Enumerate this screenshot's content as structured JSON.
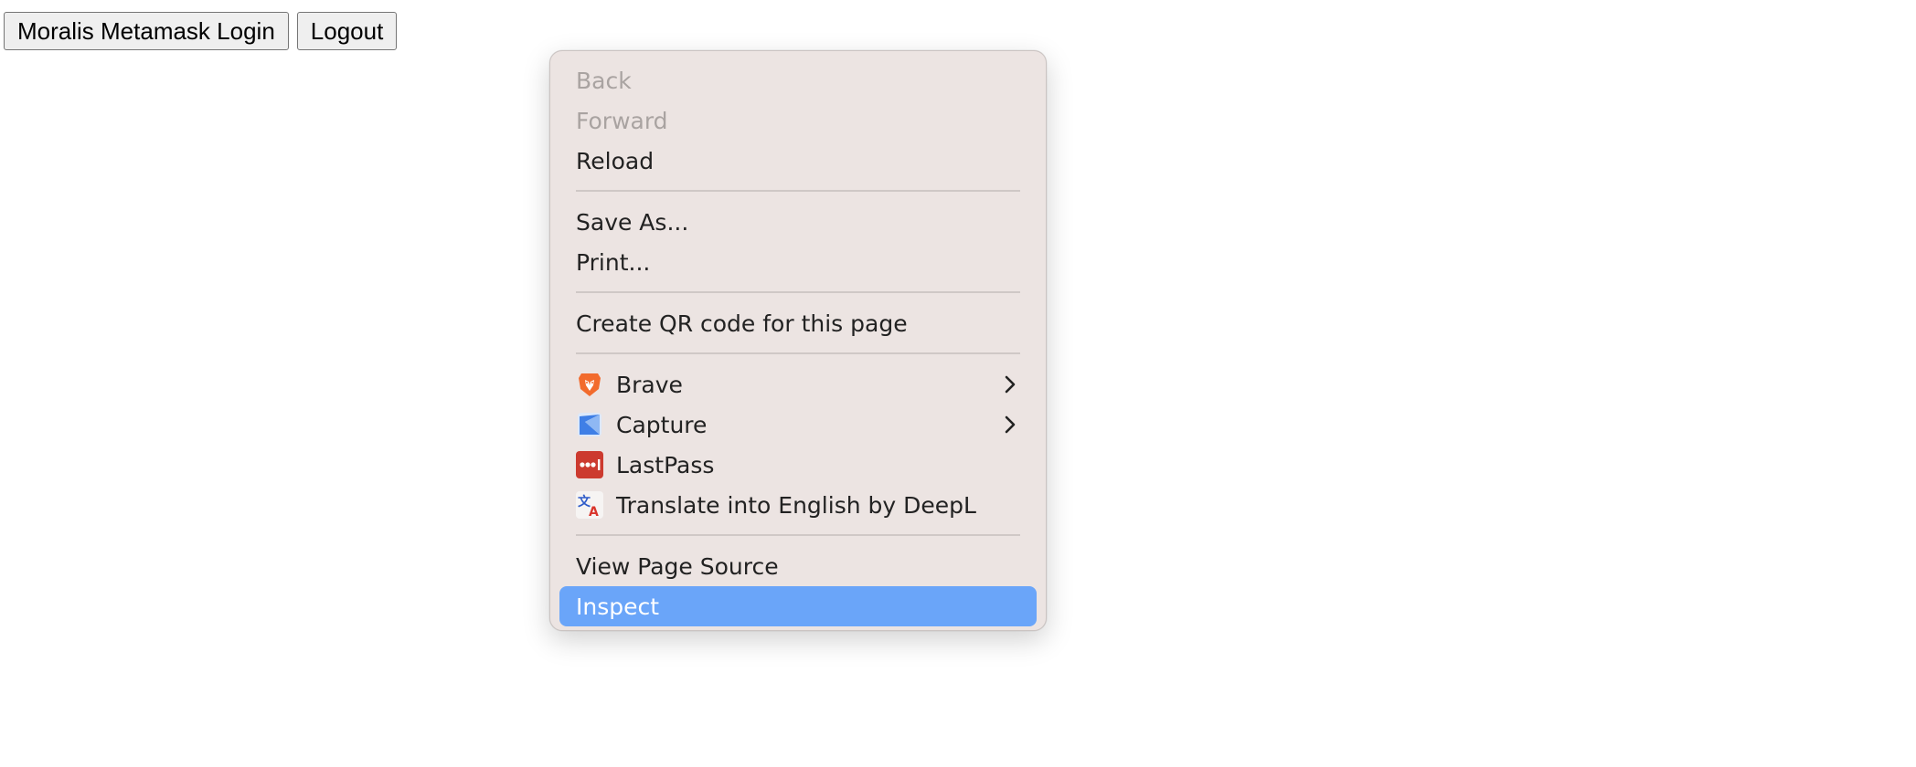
{
  "page": {
    "buttons": {
      "login_label": "Moralis Metamask Login",
      "logout_label": "Logout"
    }
  },
  "context_menu": {
    "back": "Back",
    "forward": "Forward",
    "reload": "Reload",
    "save_as": "Save As...",
    "print": "Print...",
    "create_qr": "Create QR code for this page",
    "extensions": {
      "brave": {
        "label": "Brave",
        "icon": "brave-lion-icon",
        "color": "#f26b2d"
      },
      "capture": {
        "label": "Capture",
        "icon": "capture-icon",
        "color": "#3f7fe6"
      },
      "lastpass": {
        "label": "LastPass",
        "icon": "lastpass-icon",
        "color": "#cc3a2f"
      },
      "deepl": {
        "label": "Translate into English by DeepL",
        "icon": "deepl-translate-icon",
        "color": "#2f5cc9"
      }
    },
    "view_source": "View Page Source",
    "inspect": "Inspect",
    "highlight_color": "#6aa5f9",
    "background_color": "#ece4e2"
  }
}
